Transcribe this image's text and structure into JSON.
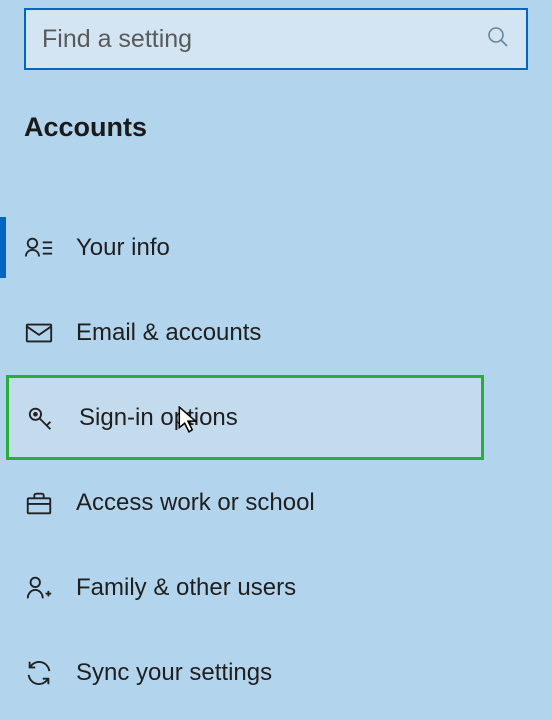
{
  "search": {
    "placeholder": "Find a setting",
    "value": ""
  },
  "section_title": "Accounts",
  "nav": {
    "items": [
      {
        "label": "Your info"
      },
      {
        "label": "Email & accounts"
      },
      {
        "label": "Sign-in options"
      },
      {
        "label": "Access work or school"
      },
      {
        "label": "Family & other users"
      },
      {
        "label": "Sync your settings"
      }
    ]
  }
}
